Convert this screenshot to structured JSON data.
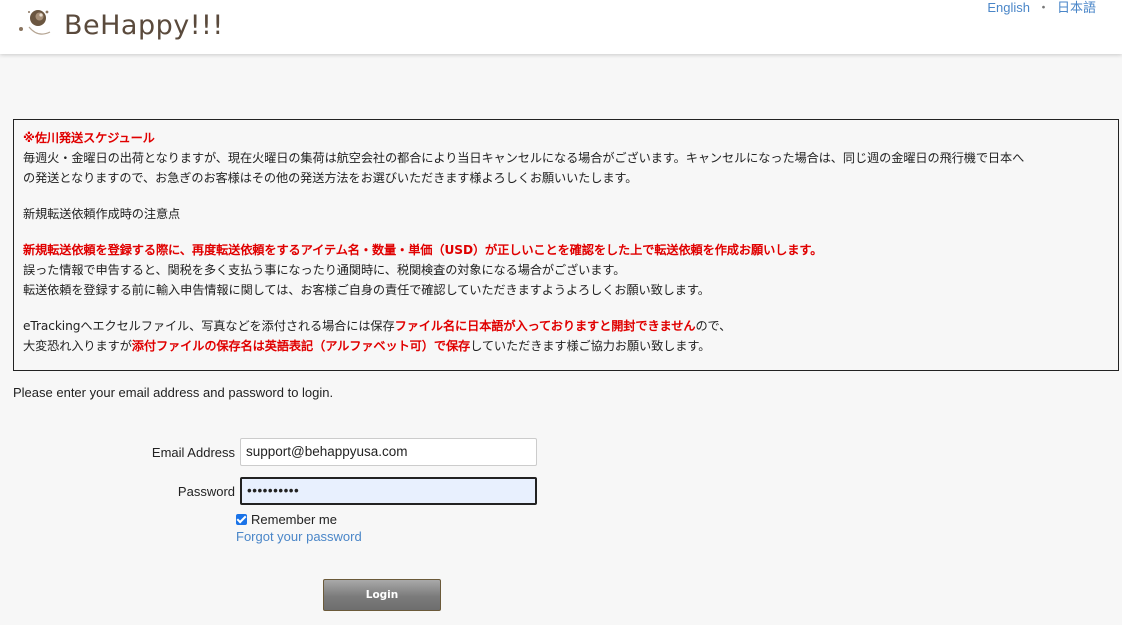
{
  "header": {
    "brand_name": "BeHappy!!!",
    "lang_english": "English",
    "lang_separator": "・",
    "lang_japanese": "日本語"
  },
  "notice": {
    "schedule_title": "※佐川発送スケジュール",
    "schedule_line1": "毎週火・金曜日の出荷となりますが、現在火曜日の集荷は航空会社の都合により当日キャンセルになる場合がございます。キャンセルになった場合は、同じ週の金曜日の飛行機で日本へ",
    "schedule_line2": "の発送となりますので、お急ぎのお客様はその他の発送方法をお選びいただきます様よろしくお願いいたします。",
    "caution_heading": "新規転送依頼作成時の注意点",
    "caution_red": "新規転送依頼を登録する際に、再度転送依頼をするアイテム名・数量・単価（USD）が正しいことを確認をした上で転送依頼を作成お願いします。",
    "caution_line1": "誤った情報で申告すると、関税を多く支払う事になったり通関時に、税関検査の対象になる場合がございます。",
    "caution_line2": "転送依頼を登録する前に輸入申告情報に関しては、お客様ご自身の責任で確認していただきますようよろしくお願い致します。",
    "etracking_a": "eTrackingへエクセルファイル、写真などを添付される場合には保存",
    "etracking_b": "ファイル名に日本語が入っておりますと開封できません",
    "etracking_c": "ので、",
    "apology_a": "大変恐れ入りますが",
    "apology_b": "添付ファイルの保存名は英語表記（アルファベット可）で保存",
    "apology_c": "していただきます様ご協力お願い致します。"
  },
  "login": {
    "intro": "Please enter your email address and password to login.",
    "email_label": "Email Address",
    "email_value": "support@behappyusa.com",
    "password_label": "Password",
    "password_value": "••••••••••",
    "remember_label": "Remember me",
    "remember_checked": true,
    "forgot_link": "Forgot your password",
    "login_button": "Login"
  },
  "colors": {
    "accent_link": "#4a86c8",
    "warning_red": "#e00000",
    "brand_brown": "#5a4a3c"
  },
  "icons": {
    "logo": "behappy-logo-icon",
    "checkbox": "checkmark-icon"
  }
}
